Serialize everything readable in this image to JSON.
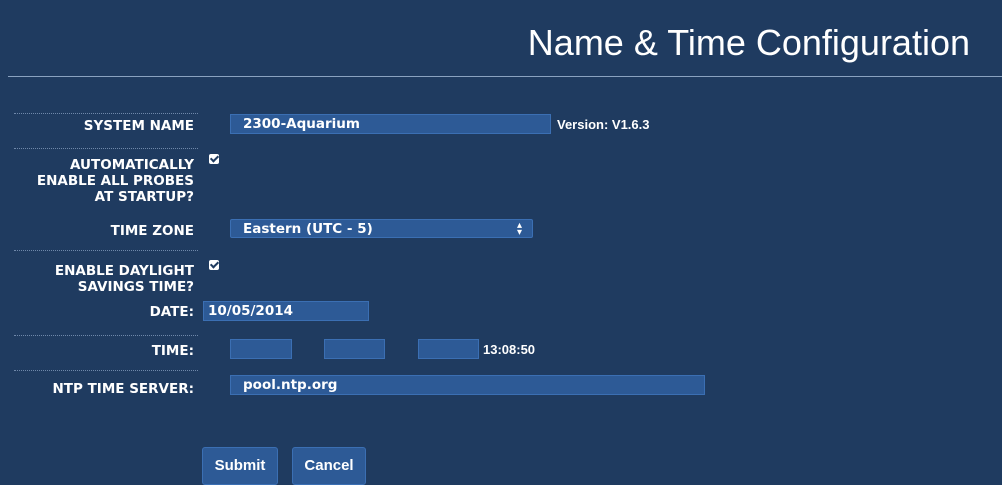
{
  "page": {
    "title": "Name & Time Configuration"
  },
  "system_name": {
    "label": "SYSTEM NAME",
    "value": "2300-Aquarium",
    "version": "Version: V1.6.3"
  },
  "auto_enable_probes": {
    "label_line1": "AUTOMATICALLY",
    "label_line2": "ENABLE ALL PROBES",
    "label_line3": "AT STARTUP?",
    "checked": true
  },
  "time_zone": {
    "label": "TIME ZONE",
    "value": "Eastern (UTC - 5)"
  },
  "daylight_savings": {
    "label_line1": "ENABLE DAYLIGHT",
    "label_line2": "SAVINGS TIME?",
    "checked": true
  },
  "date": {
    "label": "DATE:",
    "value": "10/05/2014"
  },
  "time": {
    "label": "TIME:",
    "hours": "",
    "minutes": "",
    "seconds": "",
    "current": "13:08:50"
  },
  "ntp_server": {
    "label": "NTP TIME SERVER:",
    "value": "pool.ntp.org"
  },
  "buttons": {
    "submit": "Submit",
    "cancel": "Cancel"
  },
  "colors": {
    "background": "#1f3b60",
    "field": "#2d5a96",
    "text": "#ffffff"
  }
}
